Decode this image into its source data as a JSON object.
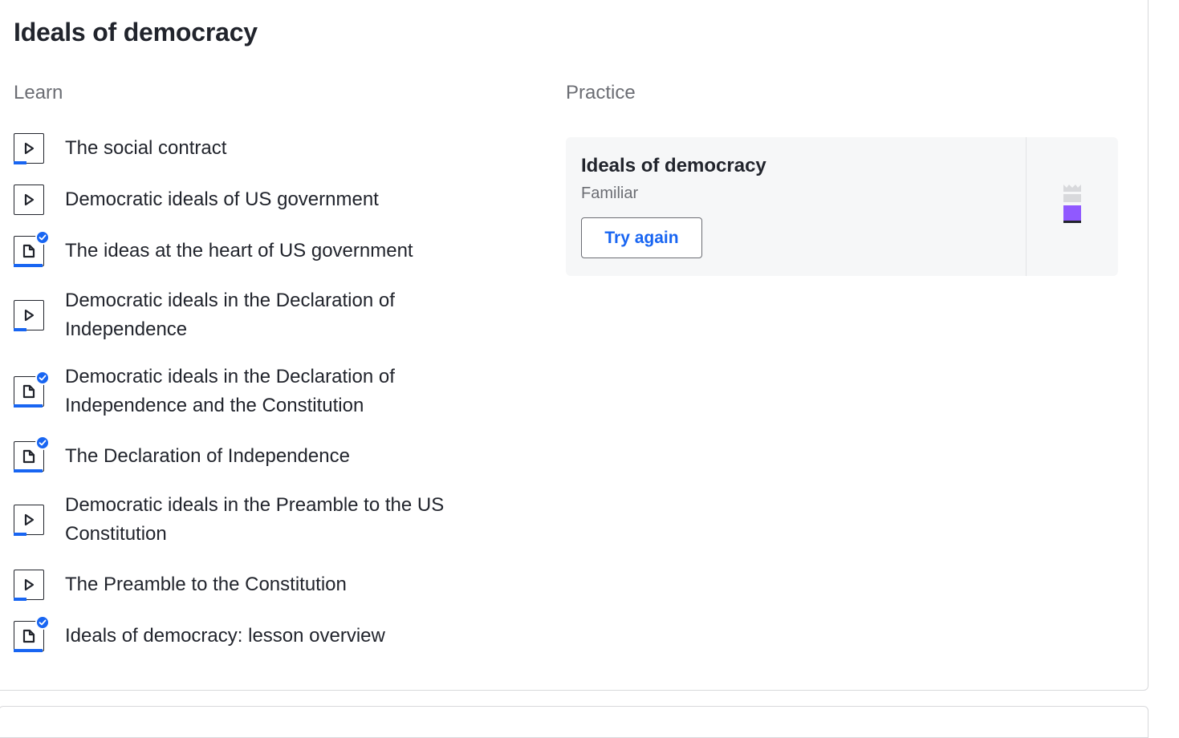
{
  "unit": {
    "title": "Ideals of democracy"
  },
  "learn": {
    "heading": "Learn",
    "items": [
      {
        "label": "The social contract",
        "type": "video",
        "icon": "play-icon",
        "completed": false,
        "progress": 0.45
      },
      {
        "label": "Democratic ideals of US government",
        "type": "video",
        "icon": "play-icon",
        "completed": false,
        "progress": 0
      },
      {
        "label": "The ideas at the heart of US government",
        "type": "article",
        "icon": "article-icon",
        "completed": true,
        "progress": 1
      },
      {
        "label": "Democratic ideals in the Declaration of Independence",
        "type": "video",
        "icon": "play-icon",
        "completed": false,
        "progress": 0.45
      },
      {
        "label": "Democratic ideals in the Declaration of Independence and the Constitution",
        "type": "article",
        "icon": "article-icon",
        "completed": true,
        "progress": 1
      },
      {
        "label": "The Declaration of Independence",
        "type": "article",
        "icon": "article-icon",
        "completed": true,
        "progress": 1
      },
      {
        "label": "Democratic ideals in the Preamble to the US Constitution",
        "type": "video",
        "icon": "play-icon",
        "completed": false,
        "progress": 0.45
      },
      {
        "label": "The Preamble to the Constitution",
        "type": "video",
        "icon": "play-icon",
        "completed": false,
        "progress": 0.45
      },
      {
        "label": "Ideals of democracy: lesson overview",
        "type": "article",
        "icon": "article-icon",
        "completed": true,
        "progress": 1
      }
    ]
  },
  "practice": {
    "heading": "Practice",
    "exercise": {
      "title": "Ideals of democracy",
      "mastery_level": "Familiar",
      "button_label": "Try again",
      "mastery_icon": "mastery-familiar-icon"
    }
  },
  "colors": {
    "accent": "#1865f2",
    "familiar": "#9059ff",
    "text": "#21242c",
    "muted": "#6b6d73"
  }
}
